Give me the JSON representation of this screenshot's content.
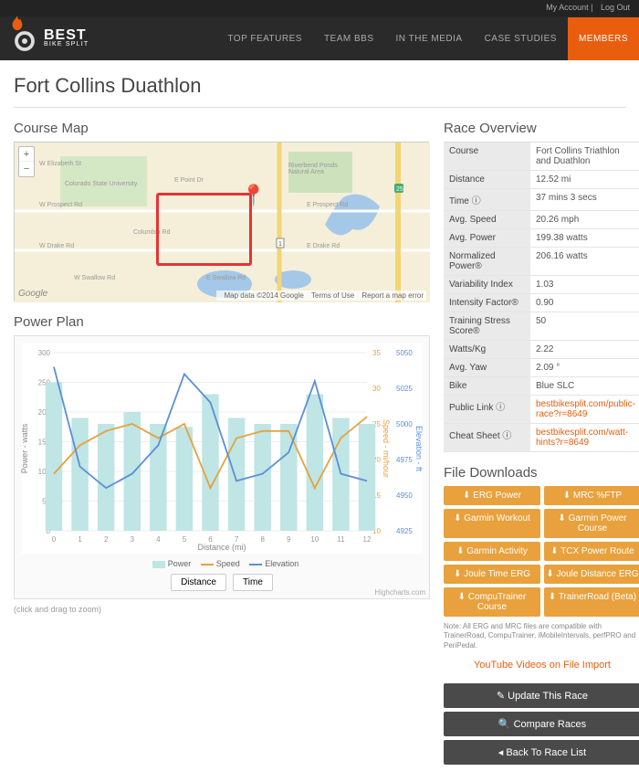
{
  "topbar": {
    "account": "My Account",
    "logout": "Log Out"
  },
  "brand": {
    "name": "BEST",
    "sub": "BIKE SPLIT"
  },
  "nav": {
    "items": [
      "TOP FEATURES",
      "TEAM BBS",
      "IN THE MEDIA",
      "CASE STUDIES",
      "MEMBERS"
    ],
    "activeIndex": 4
  },
  "page_title": "Fort Collins Duathlon",
  "map": {
    "title": "Course Map",
    "footer": {
      "data": "Map data ©2014 Google",
      "terms": "Terms of Use",
      "report": "Report a map error"
    },
    "logo": "Google",
    "roads": {
      "elizabeth": "W Elizabeth St",
      "csu": "Colorado State University",
      "prospectW": "W Prospect Rd",
      "prospectE": "E Prospect Rd",
      "drakeW": "W Drake Rd",
      "drakeE": "E Drake Rd",
      "columbia": "Columbia Rd",
      "swallowW": "W Swallow Rd",
      "swallowE": "E Swallow Rd",
      "riverbend": "Riverbend Ponds Natural Area",
      "epoint": "E Point Dr"
    }
  },
  "power": {
    "title": "Power Plan",
    "legend": {
      "power": "Power",
      "speed": "Speed",
      "elev": "Elevation"
    },
    "btns": {
      "dist": "Distance",
      "time": "Time"
    },
    "credit": "Highcharts.com",
    "zoom": "(click and drag to zoom)",
    "axes": {
      "yl": "Power - watts",
      "yr1": "Speed - mi/hour",
      "yr2": "Elevation - ft",
      "x": "Distance (mi)"
    }
  },
  "overview": {
    "title": "Race Overview",
    "rows": [
      {
        "k": "Course",
        "v": "Fort Collins Triathlon and Duathlon"
      },
      {
        "k": "Distance",
        "v": "12.52 mi"
      },
      {
        "k": "Time ⓘ",
        "v": "37 mins 3 secs"
      },
      {
        "k": "Avg. Speed",
        "v": "20.26 mph"
      },
      {
        "k": "Avg. Power",
        "v": "199.38 watts"
      },
      {
        "k": "Normalized Power®",
        "v": "206.16 watts"
      },
      {
        "k": "Variability Index",
        "v": "1.03"
      },
      {
        "k": "Intensity Factor®",
        "v": "0.90"
      },
      {
        "k": "Training Stress Score®",
        "v": "50"
      },
      {
        "k": "Watts/Kg",
        "v": "2.22"
      },
      {
        "k": "Avg. Yaw",
        "v": "2.09 °"
      },
      {
        "k": "Bike",
        "v": "Blue SLC"
      }
    ],
    "links": [
      {
        "k": "Public Link ⓘ",
        "v": "bestbikesplit.com/public-race?r=8649"
      },
      {
        "k": "Cheat Sheet ⓘ",
        "v": "bestbikesplit.com/watt-hints?r=8649"
      }
    ]
  },
  "downloads": {
    "title": "File Downloads",
    "items": [
      "ERG Power",
      "MRC %FTP",
      "Garmin Workout",
      "Garmin Power Course",
      "Garmin Activity",
      "TCX Power Route",
      "Joule Time ERG",
      "Joule Distance ERG",
      "CompuTrainer Course",
      "TrainerRoad (Beta)"
    ],
    "note": "Note: All ERG and MRC files are compatible with TrainerRoad, CompuTrainer, iMobileIntervals, perfPRO and PeriPedal.",
    "yt": "YouTube Videos on File Import"
  },
  "actions": {
    "update": "✎ Update This Race",
    "compare": "🔍 Compare Races",
    "back": "◂ Back To Race List"
  },
  "chart_data": {
    "type": "line",
    "xlabel": "Distance (mi)",
    "x": [
      0,
      1,
      2,
      3,
      4,
      5,
      6,
      7,
      8,
      9,
      10,
      11,
      12
    ],
    "series": [
      {
        "name": "Power",
        "unit": "watts",
        "type": "bar",
        "values": [
          250,
          190,
          180,
          200,
          180,
          175,
          230,
          190,
          180,
          180,
          230,
          190,
          180
        ],
        "ylim": [
          0,
          300
        ],
        "color": "#bfe5e5"
      },
      {
        "name": "Speed",
        "unit": "mi/hour",
        "type": "line",
        "values": [
          18,
          22,
          24,
          25,
          23,
          25,
          16,
          23,
          24,
          24,
          16,
          23,
          26
        ],
        "ylim": [
          10,
          35
        ],
        "color": "#e6a23c"
      },
      {
        "name": "Elevation",
        "unit": "ft",
        "type": "line",
        "values": [
          5040,
          4970,
          4955,
          4965,
          4985,
          5035,
          5015,
          4960,
          4965,
          4980,
          5030,
          4965,
          4960
        ],
        "ylim": [
          4925,
          5050
        ],
        "color": "#5b8fd6"
      }
    ]
  }
}
